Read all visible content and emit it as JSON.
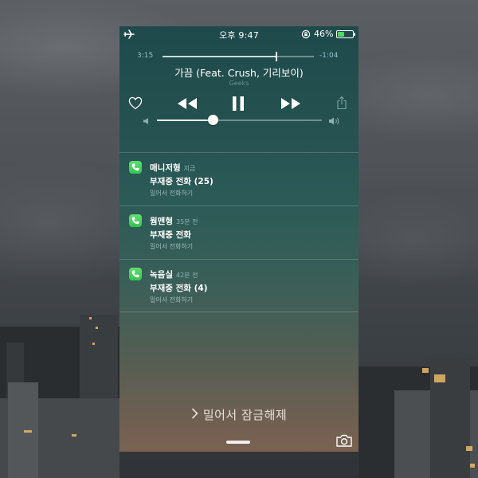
{
  "status_bar": {
    "time": "오후 9:47",
    "battery_percent": "46%",
    "battery_level": 0.46,
    "battery_color": "#4cd964",
    "icons": [
      "airplane-icon",
      "rotation-lock-icon",
      "battery-icon"
    ]
  },
  "now_playing": {
    "elapsed": "3:15",
    "remaining": "-1:04",
    "progress": 0.752,
    "title": "가끔 (Feat. Crush, 기리보이)",
    "artist": "Geeks",
    "volume": 0.34,
    "controls": [
      "heart-icon",
      "rewind-icon",
      "pause-icon",
      "fast-forward-icon",
      "share-icon",
      "volume-low-icon",
      "volume-high-icon"
    ]
  },
  "notifications": [
    {
      "sender": "매니저형",
      "time": "지금",
      "body": "부재중 전화 (25)",
      "action": "밀어서 전화하기"
    },
    {
      "sender": "웜맨형",
      "time": "35분 전",
      "body": "부재중 전화",
      "action": "밀어서 전화하기"
    },
    {
      "sender": "녹음실",
      "time": "42분 전",
      "body": "부재중 전화 (4)",
      "action": "밀어서 전화하기"
    }
  ],
  "lock_screen": {
    "unlock_text": "밀어서 잠금해제",
    "icons": [
      "chevron-right-icon",
      "camera-icon"
    ]
  }
}
